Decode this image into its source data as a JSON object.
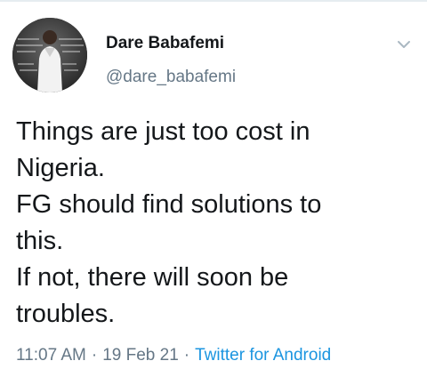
{
  "tweet": {
    "author": {
      "display_name": "Dare Babafemi",
      "handle": "@dare_babafemi",
      "avatar_icon": "profile-photo"
    },
    "menu_icon": "chevron-down-icon",
    "text_lines": [
      "Things are just too cost in",
      "Nigeria.",
      "FG should find solutions to",
      "this.",
      "If not, there will soon be",
      "troubles."
    ],
    "meta": {
      "time": "11:07 AM",
      "separator": "·",
      "date": "19 Feb 21",
      "source": "Twitter for Android"
    }
  },
  "colors": {
    "text_primary": "#14171a",
    "text_secondary": "#657786",
    "link": "#1b95e0",
    "divider": "#e6ecf0"
  }
}
